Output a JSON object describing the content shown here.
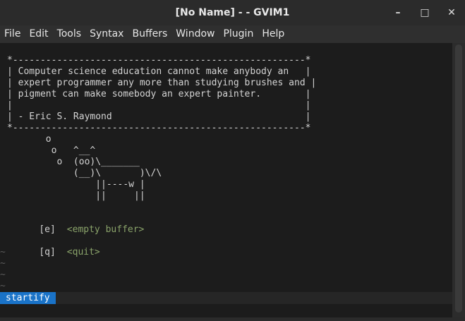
{
  "window": {
    "title": "[No Name] - - GVIM1",
    "minimize_glyph": "–",
    "maximize_glyph": "□",
    "close_glyph": "✕"
  },
  "menubar": {
    "items": [
      "File",
      "Edit",
      "Tools",
      "Syntax",
      "Buffers",
      "Window",
      "Plugin",
      "Help"
    ]
  },
  "editor": {
    "banner": "*-----------------------------------------------------*\n| Computer science education cannot make anybody an   |\n| expert programmer any more than studying brushes and |\n| pigment can make somebody an expert painter.        |\n|                                                     |\n| - Eric S. Raymond                                   |\n*-----------------------------------------------------*\n       o\n        o   ^__^\n         o  (oo)\\_______\n            (__)\\       )\\/\\\n                ||----w |\n                ||     ||",
    "menu": [
      {
        "key": "[e]",
        "label": "<empty buffer>"
      },
      {
        "key": "[q]",
        "label": "<quit>"
      }
    ],
    "tilde": "~"
  },
  "statusline": {
    "mode": "startify"
  },
  "colors": {
    "background": "#1c1c1c",
    "text": "#d4d4d4",
    "menu_label": "#8aa36a",
    "tilde": "#5a5a5a",
    "status_accent": "#1a73c8"
  }
}
